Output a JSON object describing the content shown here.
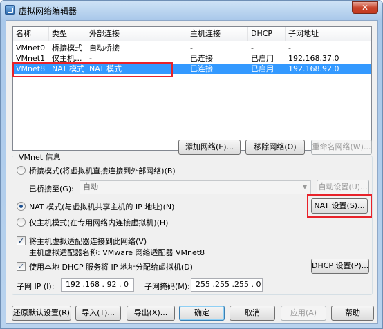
{
  "window": {
    "title": "虚拟网络编辑器",
    "close_glyph": "✕"
  },
  "table": {
    "columns": [
      "名称",
      "类型",
      "外部连接",
      "主机连接",
      "DHCP",
      "子网地址"
    ],
    "rows": [
      [
        "VMnet0",
        "桥接模式",
        "自动桥接",
        "-",
        "-",
        "-"
      ],
      [
        "VMnet1",
        "仅主机...",
        "-",
        "已连接",
        "已启用",
        "192.168.37.0"
      ],
      [
        "VMnet8",
        "NAT 模式",
        "NAT 模式",
        "已连接",
        "已启用",
        "192.168.92.0"
      ]
    ],
    "selected_index": 2
  },
  "network_buttons": {
    "add": "添加网络(E)...",
    "remove": "移除网络(O)",
    "rename": "重命名网络(W)..."
  },
  "vmnet_info": {
    "title": "VMnet 信息",
    "bridge_label": "桥接模式(将虚拟机直接连接到外部网络)(B)",
    "bridged_to_label": "已桥接至(G):",
    "bridged_to_value": "自动",
    "auto_settings": "自动设置(U)...",
    "nat_label": "NAT 模式(与虚拟机共享主机的 IP 地址)(N)",
    "nat_settings": "NAT 设置(S)...",
    "host_only_label": "仅主机模式(在专用网络内连接虚拟机)(H)",
    "connect_adapter_label": "将主机虚拟适配器连接到此网络(V)",
    "adapter_name_label": "主机虚拟适配器名称: VMware 网络适配器 VMnet8",
    "dhcp_label": "使用本地 DHCP 服务将 IP 地址分配给虚拟机(D)",
    "dhcp_settings": "DHCP 设置(P)...",
    "selected_mode": "nat",
    "connect_adapter_checked": true,
    "dhcp_checked": true
  },
  "subnet": {
    "ip_label": "子网 IP (I):",
    "ip_value": "192 .168 . 92 . 0",
    "mask_label": "子网掩码(M):",
    "mask_value": "255 .255 .255 . 0"
  },
  "footer": {
    "restore": "还原默认设置(R)",
    "import": "导入(T)...",
    "export": "导出(X)...",
    "ok": "确定",
    "cancel": "取消",
    "apply": "应用(A)",
    "help": "帮助"
  },
  "colors": {
    "selection": "#3399ff",
    "highlight_box": "#e8222a",
    "title_gradient_top": "#cfe3f6"
  }
}
